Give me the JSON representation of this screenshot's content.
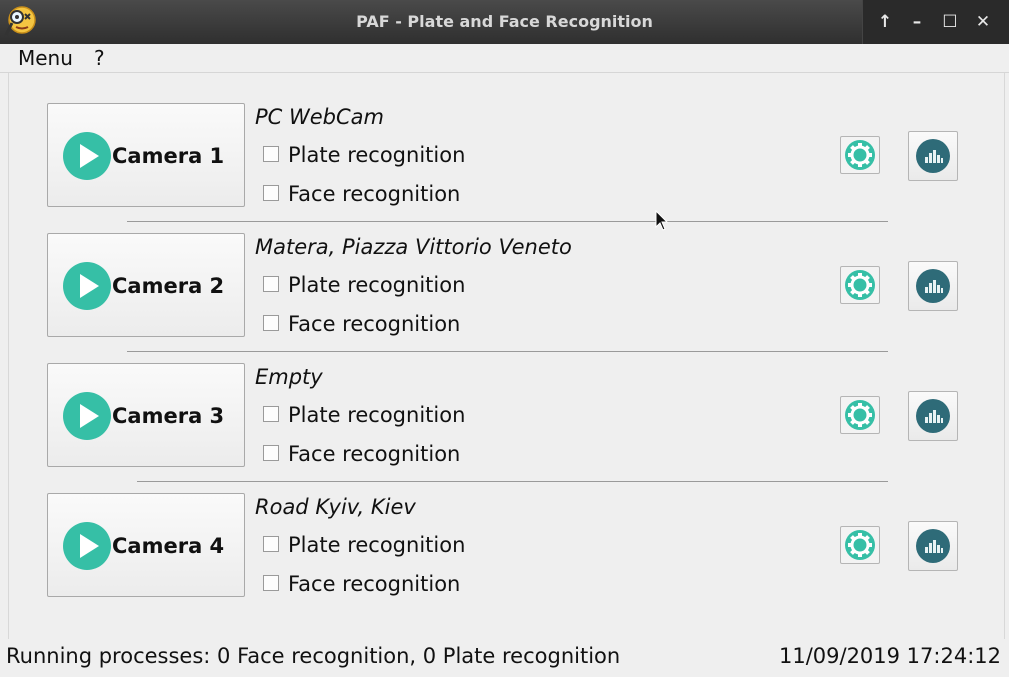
{
  "window": {
    "title": "PAF - Plate and Face Recognition",
    "app_icon": "magnifier-face-icon",
    "controls": [
      "arrow-up-icon",
      "minimize-icon",
      "maximize-icon",
      "close-icon"
    ],
    "controls_glyphs": {
      "up": "↑",
      "min": "–",
      "max": "☐",
      "close": "✕"
    }
  },
  "menu": {
    "items": [
      {
        "label": "Menu"
      },
      {
        "label": "?"
      }
    ]
  },
  "cameras": [
    {
      "button_label": "Camera 1",
      "name": "PC WebCam",
      "plate_label": "Plate recognition",
      "face_label": "Face recognition",
      "plate_checked": false,
      "face_checked": false
    },
    {
      "button_label": "Camera 2",
      "name": "Matera, Piazza Vittorio Veneto",
      "plate_label": "Plate recognition",
      "face_label": "Face recognition",
      "plate_checked": false,
      "face_checked": false
    },
    {
      "button_label": "Camera 3",
      "name": "Empty",
      "plate_label": "Plate recognition",
      "face_label": "Face recognition",
      "plate_checked": false,
      "face_checked": false
    },
    {
      "button_label": "Camera 4",
      "name": "Road Kyiv, Kiev",
      "plate_label": "Plate recognition",
      "face_label": "Face recognition",
      "plate_checked": false,
      "face_checked": false
    }
  ],
  "status": {
    "processes": "Running processes: 0 Face recognition, 0 Plate recognition",
    "datetime": "11/09/2019 17:24:12"
  },
  "colors": {
    "accent_teal": "#36bfa6",
    "dark_teal": "#2e6b78",
    "titlebar": "#3a3a3a"
  }
}
